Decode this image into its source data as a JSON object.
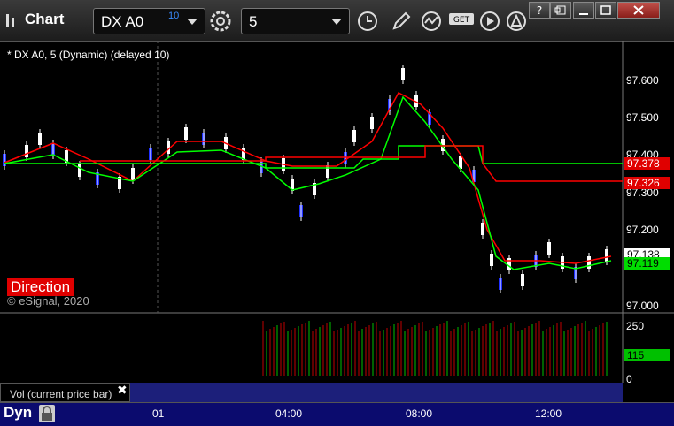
{
  "app": {
    "title": "Chart"
  },
  "toolbar": {
    "symbol": "DX A0",
    "symbol_badge": "10",
    "interval": "5"
  },
  "chart": {
    "series_label": "* DX A0, 5 (Dynamic) (delayed 10)",
    "indicator_label": "Direction",
    "copyright": "© eSignal, 2020",
    "price_tags": [
      {
        "value": "97.378",
        "color": "#e00000",
        "text_color": "#ffffff"
      },
      {
        "value": "97.326",
        "color": "#e00000",
        "text_color": "#ffffff"
      },
      {
        "value": "97.138",
        "color": "#ffffff",
        "text_color": "#000000"
      },
      {
        "value": "97.119",
        "color": "#00dd00",
        "text_color": "#000000"
      }
    ],
    "y_ticks": [
      "97.600",
      "97.500",
      "97.400",
      "97.300",
      "97.200",
      "97.100",
      "97.000"
    ],
    "x_ticks": [
      "01",
      "04:00",
      "08:00",
      "12:00"
    ]
  },
  "volume": {
    "label": "Vol (current price bar)",
    "y_ticks": [
      "250",
      "0"
    ],
    "last_value": "115",
    "last_color": "#00c000"
  },
  "status": {
    "mode": "Dyn"
  },
  "colors": {
    "up_bar": "#ffffff",
    "down_bar": "#2030ff",
    "ma_red": "#ff0000",
    "ma_green": "#00ff00"
  }
}
